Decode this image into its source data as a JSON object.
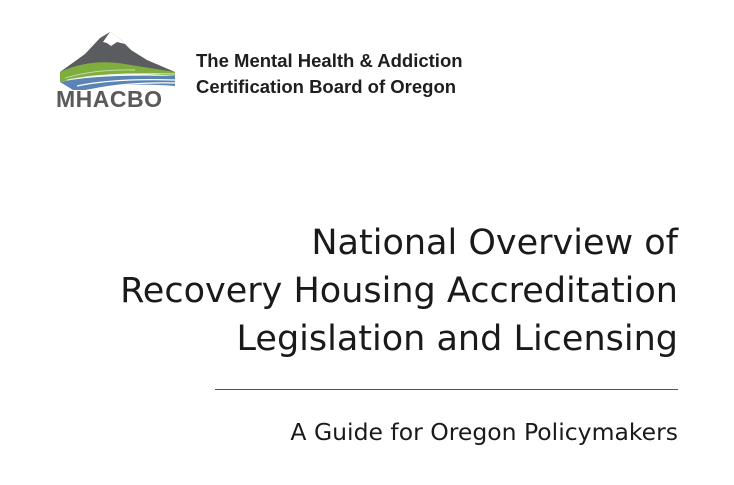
{
  "logo": {
    "text": "MHACBO",
    "icon": "mountain-valley-logo-icon"
  },
  "organization": {
    "line1": "The Mental Health & Addiction",
    "line2": "Certification Board of Oregon"
  },
  "title": {
    "line1": "National Overview of",
    "line2": "Recovery Housing Accreditation",
    "line3": "Legislation and Licensing"
  },
  "subtitle": "A Guide for Oregon Policymakers",
  "colors": {
    "logo_gray": "#5a5a5c",
    "logo_green": "#7fae3e",
    "logo_blue": "#5b83b3",
    "text": "#1a1a1a"
  }
}
